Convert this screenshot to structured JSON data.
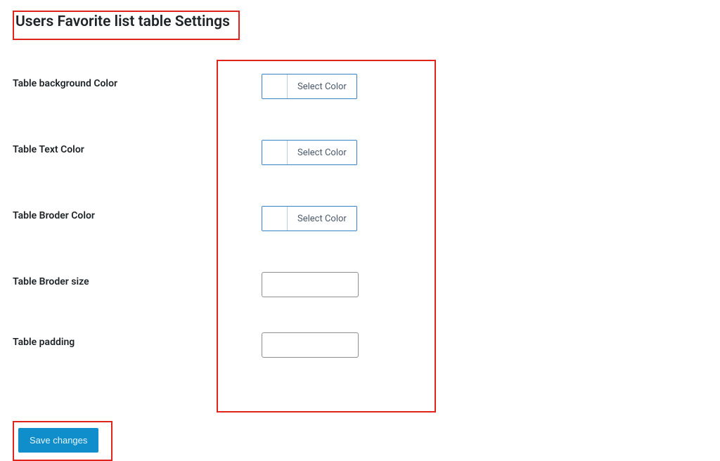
{
  "page_title": "Users Favorite list table Settings",
  "fields": {
    "bg_color": {
      "label": "Table background Color",
      "button_text": "Select Color"
    },
    "text_color": {
      "label": "Table Text Color",
      "button_text": "Select Color"
    },
    "border_color": {
      "label": "Table Broder Color",
      "button_text": "Select Color"
    },
    "border_size": {
      "label": "Table Broder size",
      "value": ""
    },
    "padding": {
      "label": "Table padding",
      "value": ""
    }
  },
  "save_button": "Save changes"
}
